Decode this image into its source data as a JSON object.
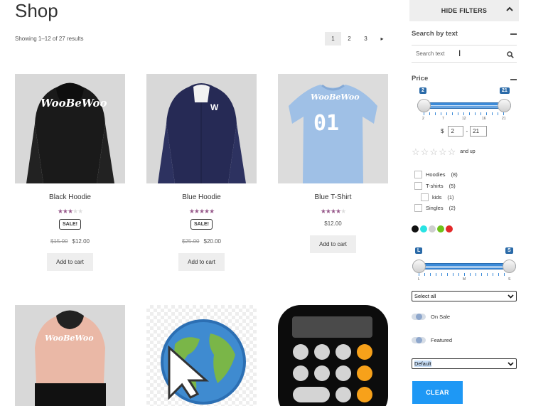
{
  "page": {
    "title": "Shop",
    "results": "Showing 1–12 of 27 results"
  },
  "pagination": {
    "pages": [
      "1",
      "2",
      "3"
    ],
    "next": "▸"
  },
  "products": [
    {
      "name": "Black Hoodie",
      "rating": 3,
      "sale": "SALE!",
      "old_price": "$15.00",
      "price": "$12.00",
      "button": "Add to cart",
      "logo": "WooBeWoo"
    },
    {
      "name": "Blue Hoodie",
      "rating": 5,
      "sale": "SALE!",
      "old_price": "$25.00",
      "price": "$20.00",
      "button": "Add to cart",
      "logo": "W"
    },
    {
      "name": "Blue T-Shirt",
      "rating": 4,
      "price": "$12.00",
      "button": "Add to cart",
      "logo": "WooBeWoo",
      "number": "01"
    },
    {
      "logo": "WooBeWoo"
    }
  ],
  "sidebar": {
    "hide_filters": "HIDE FILTERS",
    "search_heading": "Search by text",
    "search_placeholder": "Search text",
    "price_heading": "Price",
    "price_min_tag": "2",
    "price_max_tag": "21",
    "price_ticks": [
      "2",
      "7",
      "12",
      "16",
      "21"
    ],
    "currency": "$",
    "price_min": "2",
    "price_max": "21",
    "and_up": "and up",
    "categories": [
      {
        "label": "Hoodies",
        "count": "(8)"
      },
      {
        "label": "T-shirts",
        "count": "(5)"
      },
      {
        "label": "kids",
        "count": "(1)"
      },
      {
        "label": "Singles",
        "count": "(2)"
      }
    ],
    "colors": [
      "#111111",
      "#29e3e3",
      "#cfcfcf",
      "#6fc21a",
      "#e32929"
    ],
    "size_min_tag": "L",
    "size_max_tag": "S",
    "size_ticks": [
      "L",
      "M",
      "S"
    ],
    "select_all": "Select all",
    "on_sale": "On Sale",
    "featured": "Featured",
    "sort_default": "Default",
    "clear": "CLEAR"
  }
}
